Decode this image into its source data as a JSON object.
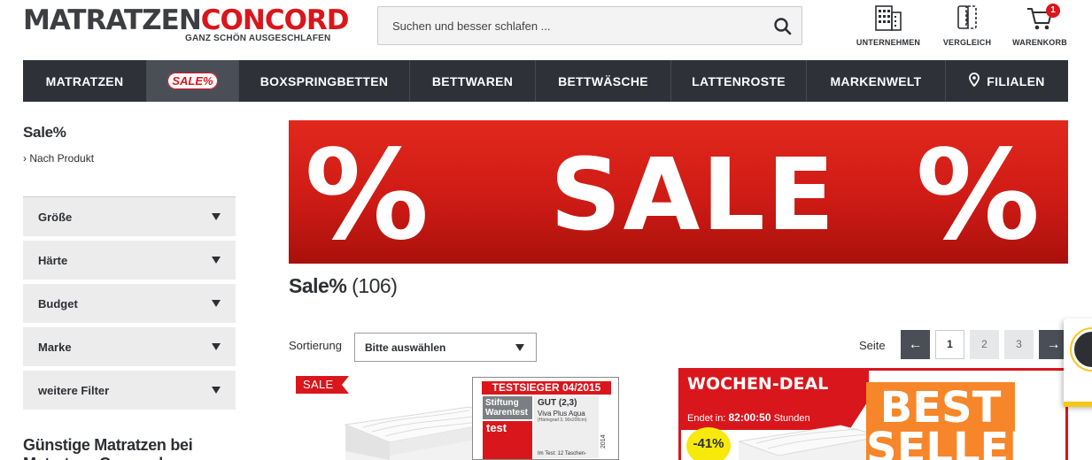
{
  "header": {
    "logo_part1": "MATRATZEN",
    "logo_part2": "CONCORD",
    "logo_tagline": "GANZ SCHÖN AUSGESCHLAFEN",
    "search_placeholder": "Suchen und besser schlafen ...",
    "icons": [
      {
        "label": "UNTERNEHMEN",
        "icon": "building-icon"
      },
      {
        "label": "VERGLEICH",
        "icon": "compare-icon"
      },
      {
        "label": "WARENKORB",
        "icon": "cart-icon",
        "badge": "1"
      }
    ]
  },
  "nav": {
    "items": [
      {
        "label": "MATRATZEN"
      },
      {
        "label": "SALE%"
      },
      {
        "label": "BOXSPRINGBETTEN"
      },
      {
        "label": "BETTWAREN"
      },
      {
        "label": "BETTWÄSCHE"
      },
      {
        "label": "LATTENROSTE"
      },
      {
        "label": "MARKENWELT"
      },
      {
        "label": "FILIALEN"
      }
    ]
  },
  "sidebar": {
    "title": "Sale%",
    "link": "› Nach Produkt",
    "filters": [
      "Größe",
      "Härte",
      "Budget",
      "Marke",
      "weitere Filter"
    ],
    "bottom_heading": "Günstige Matratzen bei Matratzen Concord"
  },
  "banner": {
    "pct_left": "%",
    "text": "SALE",
    "pct_right": "%"
  },
  "results": {
    "title": "Sale%",
    "count": "(106)"
  },
  "sort": {
    "label": "Sortierung",
    "selected": "Bitte auswählen"
  },
  "pagination": {
    "label": "Seite",
    "prev": "←",
    "pages": [
      "1",
      "2",
      "3"
    ],
    "current": "1",
    "next": "→"
  },
  "products": {
    "p1": {
      "tag": "SALE",
      "test_header": "TESTSIEGER 04/2015",
      "test_org": "Stiftung Warentest",
      "test_mag": "test",
      "grade": "GUT (2,3)",
      "product": "Viva Plus Aqua",
      "detail": "(Härtegrad 3, 90x200cm)",
      "tested": "Im Test: 12 Taschen-",
      "issue": "2014"
    },
    "p2": {
      "deal_title": "WOCHEN-DEAL",
      "ends_prefix": "Endet in:",
      "timer": "82:00:50",
      "ends_suffix": "Stunden",
      "discount": "-41%",
      "badge": "BEST SELLER"
    }
  },
  "colors": {
    "brand_red": "#d9161c",
    "nav_dark": "#2e3238",
    "deal_yellow": "#f6e90b",
    "bestseller_orange": "#f7862a"
  }
}
